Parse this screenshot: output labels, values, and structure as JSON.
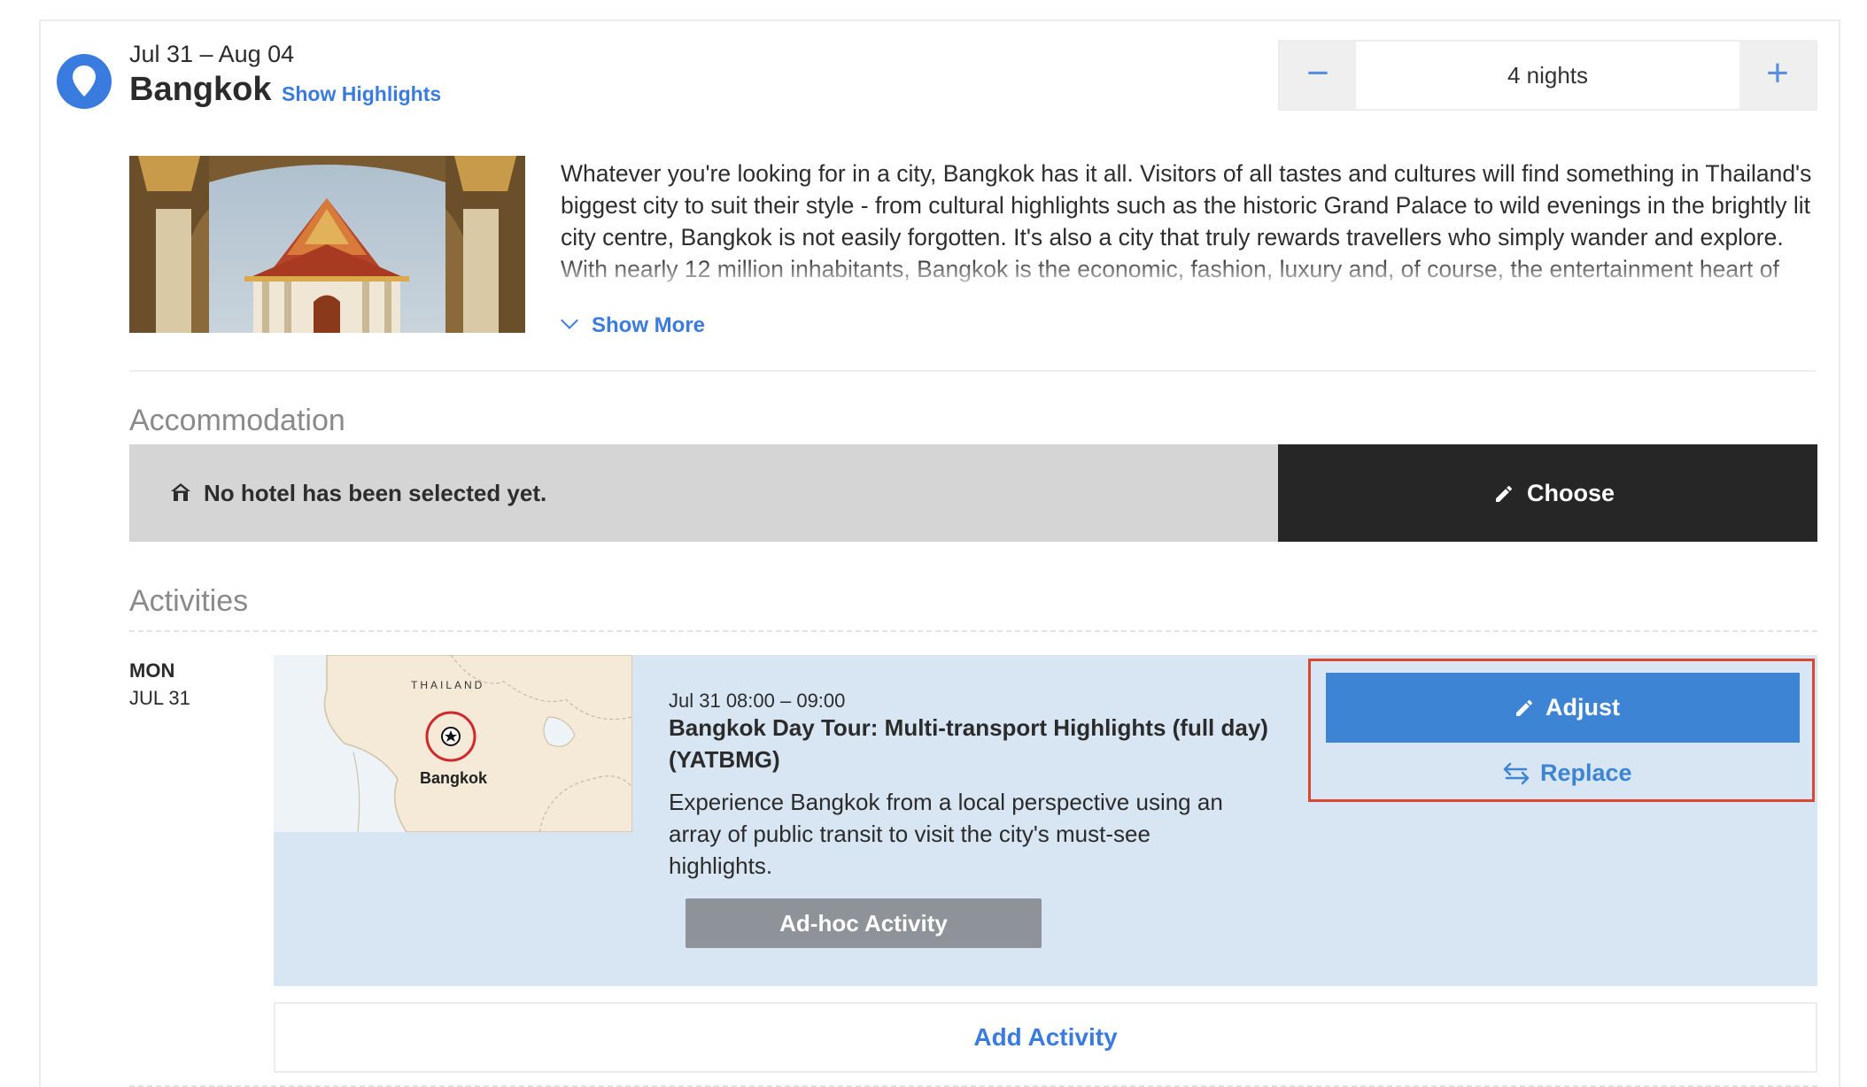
{
  "destination": {
    "dates": "Jul 31 – Aug 04",
    "city": "Bangkok",
    "show_highlights_label": "Show Highlights",
    "description": "Whatever you're looking for in a city, Bangkok has it all. Visitors of all tastes and cultures will find something in Thailand's biggest city to suit their style - from cultural highlights such as the historic Grand Palace to wild evenings in the brightly lit city centre, Bangkok is not easily forgotten. It's also a city that truly rewards travellers who simply wander and explore. With nearly 12 million inhabitants, Bangkok is the economic, fashion, luxury and, of course, the entertainment heart of Southeast Asia.",
    "show_more_label": "Show More",
    "icon": "location-pin-icon",
    "accent_color": "#3a7be0"
  },
  "stepper": {
    "minus_label": "−",
    "value_label": "4 nights",
    "plus_label": "+"
  },
  "accommodation": {
    "title": "Accommodation",
    "empty_text": "No hotel has been selected yet.",
    "choose_label": "Choose"
  },
  "activities": {
    "title": "Activities",
    "day": {
      "dow": "MON",
      "date": "JUL 31"
    },
    "item": {
      "map_country": "THAILAND",
      "map_city": "Bangkok",
      "time": "Jul 31 08:00 – 09:00",
      "title": "Bangkok Day Tour: Multi-transport Highlights (full day) (YATBMG)",
      "description": "Experience Bangkok from a local perspective using an array of public transit to visit the city's must-see highlights.",
      "adhoc_label": "Ad-hoc Activity",
      "adjust_label": "Adjust",
      "replace_label": "Replace"
    },
    "add_label": "Add Activity"
  }
}
